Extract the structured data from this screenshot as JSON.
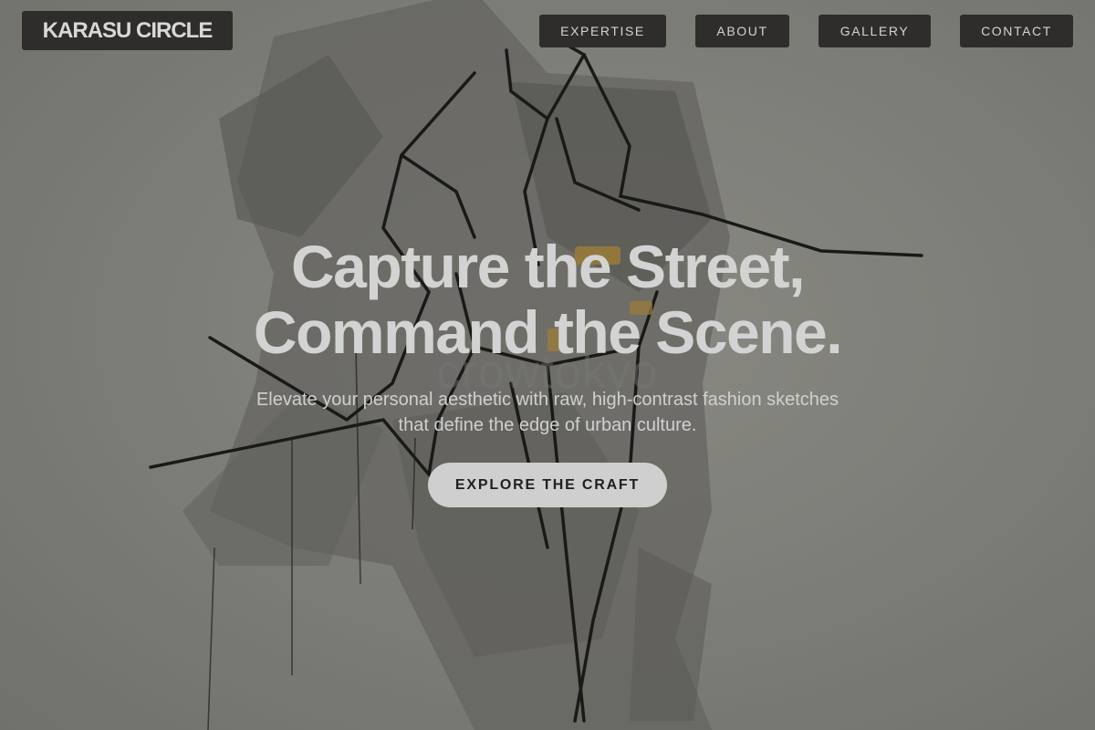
{
  "header": {
    "logo_text": "KARASU CIRCLE",
    "nav": {
      "expertise": "EXPERTISE",
      "about": "ABOUT",
      "gallery": "GALLERY",
      "contact": "CONTACT"
    }
  },
  "hero": {
    "title_line1": "Capture the Street,",
    "title_line2": "Command the Scene.",
    "subtitle_line1": "Elevate your personal aesthetic with raw, high-contrast fashion sketches",
    "subtitle_line2": "that define the edge of urban culture.",
    "cta_label": "EXPLORE THE CRAFT",
    "watermark": "crowtokyo"
  },
  "colors": {
    "nav_bg": "#2e2d2c",
    "nav_text": "#d4d4d4",
    "cta_bg": "#cfcfcf",
    "cta_text": "#1f1f1f",
    "accent_gold": "#b08a3a"
  },
  "background_image": "ink-wash fashion sketch of a figure in a coat"
}
